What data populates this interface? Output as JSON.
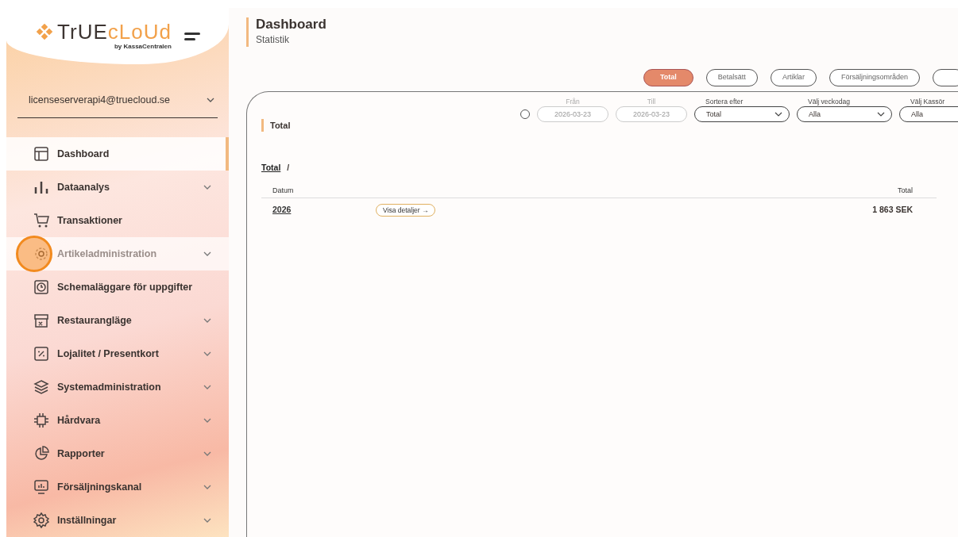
{
  "logo": {
    "word_dark": "TrUE",
    "word_light": "cLoUd",
    "tagline": "by KassaCentralen"
  },
  "account": {
    "email": "licenseserverapi4@truecloud.se"
  },
  "sidebar": {
    "items": [
      {
        "label": "Dashboard",
        "selected": true,
        "hovered": false,
        "expandable": false
      },
      {
        "label": "Dataanalys",
        "selected": false,
        "hovered": false,
        "expandable": true
      },
      {
        "label": "Transaktioner",
        "selected": false,
        "hovered": false,
        "expandable": false
      },
      {
        "label": "Artikeladministration",
        "selected": false,
        "hovered": true,
        "expandable": true
      },
      {
        "label": "Schemaläggare för uppgifter",
        "selected": false,
        "hovered": false,
        "expandable": false
      },
      {
        "label": "Restaurangläge",
        "selected": false,
        "hovered": false,
        "expandable": true
      },
      {
        "label": "Lojalitet / Presentkort",
        "selected": false,
        "hovered": false,
        "expandable": true
      },
      {
        "label": "Systemadministration",
        "selected": false,
        "hovered": false,
        "expandable": true
      },
      {
        "label": "Hårdvara",
        "selected": false,
        "hovered": false,
        "expandable": true
      },
      {
        "label": "Rapporter",
        "selected": false,
        "hovered": false,
        "expandable": true
      },
      {
        "label": "Försäljningskanal",
        "selected": false,
        "hovered": false,
        "expandable": true
      },
      {
        "label": "Inställningar",
        "selected": false,
        "hovered": false,
        "expandable": true
      }
    ]
  },
  "header": {
    "title": "Dashboard",
    "subtitle": "Statistik"
  },
  "tabs": [
    {
      "label": "Total",
      "selected": true
    },
    {
      "label": "Betalsätt",
      "selected": false
    },
    {
      "label": "Artiklar",
      "selected": false
    },
    {
      "label": "Försäljningsområden",
      "selected": false
    }
  ],
  "card": {
    "title": "Total",
    "filters": {
      "range_toggle": {
        "checked": false
      },
      "fields": [
        {
          "kind": "date",
          "label": "Från",
          "value": "2026-03-23",
          "disabled": true
        },
        {
          "kind": "date",
          "label": "Till",
          "value": "2026-03-23",
          "disabled": true
        },
        {
          "kind": "select",
          "label": "Sortera efter",
          "value": "Total",
          "disabled": false
        },
        {
          "kind": "select",
          "label": "Välj veckodag",
          "value": "Alla",
          "disabled": false
        },
        {
          "kind": "select",
          "label": "Välj Kassör",
          "value": "Alla",
          "disabled": false
        }
      ]
    },
    "breadcrumb": {
      "link": "Total",
      "separator": "/"
    },
    "table": {
      "columns": [
        "Datum",
        "Total"
      ],
      "rows": [
        {
          "date": "2026",
          "action": "Visa detaljer →",
          "total": "1 863 SEK"
        }
      ]
    }
  }
}
